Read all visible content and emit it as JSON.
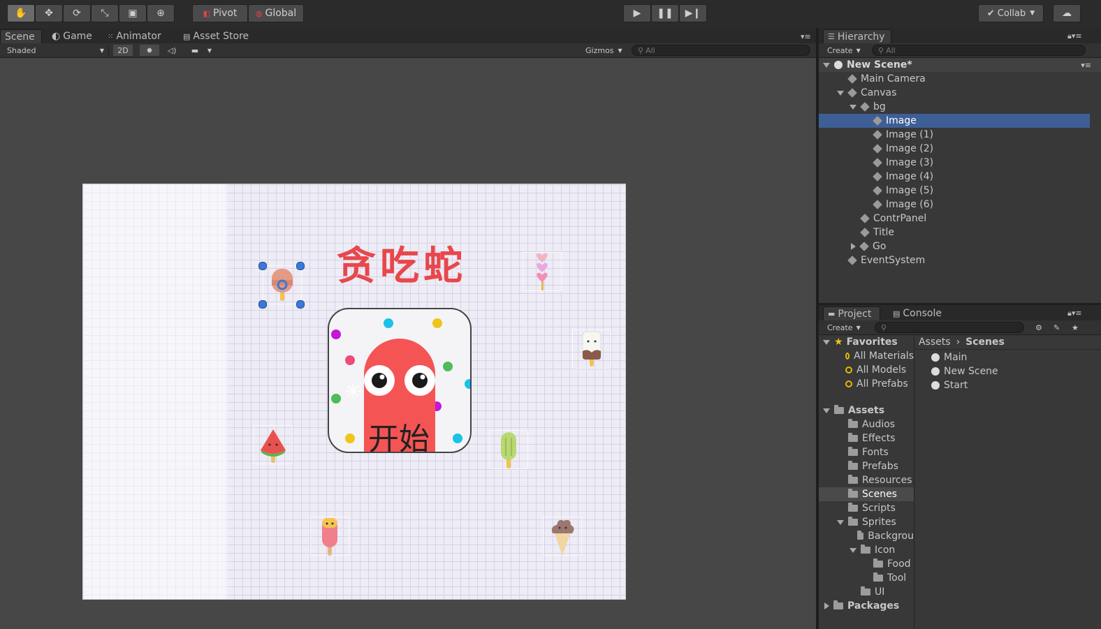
{
  "toolbar": {
    "pivot_label": "Pivot",
    "global_label": "Global",
    "collab_label": "Collab"
  },
  "scene_tabs": [
    {
      "label": "Scene",
      "selected": true
    },
    {
      "label": "Game",
      "selected": false
    },
    {
      "label": "Animator",
      "selected": false
    },
    {
      "label": "Asset Store",
      "selected": false
    }
  ],
  "scene_bar": {
    "shading_mode": "Shaded",
    "mode_2d": "2D",
    "gizmos_label": "Gizmos",
    "search_placeholder": "All"
  },
  "game": {
    "title": "贪吃蛇",
    "start_label": "开始",
    "title_color": "#e8474c",
    "ghost_color": "#f55454"
  },
  "hierarchy": {
    "tab_label": "Hierarchy",
    "create_label": "Create",
    "search_placeholder": "All",
    "scene_name": "New Scene*",
    "items": [
      {
        "label": "Main Camera",
        "depth": 1,
        "arrow": "",
        "selected": false
      },
      {
        "label": "Canvas",
        "depth": 1,
        "arrow": "down",
        "selected": false
      },
      {
        "label": "bg",
        "depth": 2,
        "arrow": "down",
        "selected": false
      },
      {
        "label": "Image",
        "depth": 3,
        "arrow": "",
        "selected": true
      },
      {
        "label": "Image (1)",
        "depth": 3,
        "arrow": "",
        "selected": false
      },
      {
        "label": "Image (2)",
        "depth": 3,
        "arrow": "",
        "selected": false
      },
      {
        "label": "Image (3)",
        "depth": 3,
        "arrow": "",
        "selected": false
      },
      {
        "label": "Image (4)",
        "depth": 3,
        "arrow": "",
        "selected": false
      },
      {
        "label": "Image (5)",
        "depth": 3,
        "arrow": "",
        "selected": false
      },
      {
        "label": "Image (6)",
        "depth": 3,
        "arrow": "",
        "selected": false
      },
      {
        "label": "ContrPanel",
        "depth": 2,
        "arrow": "",
        "selected": false
      },
      {
        "label": "Title",
        "depth": 2,
        "arrow": "",
        "selected": false
      },
      {
        "label": "Go",
        "depth": 2,
        "arrow": "right",
        "selected": false
      },
      {
        "label": "EventSystem",
        "depth": 1,
        "arrow": "",
        "selected": false
      }
    ]
  },
  "project": {
    "tab_project": "Project",
    "tab_console": "Console",
    "create_label": "Create",
    "favorites_label": "Favorites",
    "favorites": [
      "All Materials",
      "All Models",
      "All Prefabs"
    ],
    "assets_label": "Assets",
    "folders": [
      {
        "label": "Audios",
        "depth": 1,
        "arrow": "",
        "selected": false
      },
      {
        "label": "Effects",
        "depth": 1,
        "arrow": "",
        "selected": false
      },
      {
        "label": "Fonts",
        "depth": 1,
        "arrow": "",
        "selected": false
      },
      {
        "label": "Prefabs",
        "depth": 1,
        "arrow": "",
        "selected": false
      },
      {
        "label": "Resources",
        "depth": 1,
        "arrow": "",
        "selected": false
      },
      {
        "label": "Scenes",
        "depth": 1,
        "arrow": "",
        "selected": true
      },
      {
        "label": "Scripts",
        "depth": 1,
        "arrow": "",
        "selected": false
      },
      {
        "label": "Sprites",
        "depth": 1,
        "arrow": "down",
        "selected": false
      },
      {
        "label": "Backgrou",
        "depth": 2,
        "arrow": "",
        "selected": false
      },
      {
        "label": "Icon",
        "depth": 2,
        "arrow": "down",
        "selected": false
      },
      {
        "label": "Food",
        "depth": 3,
        "arrow": "",
        "selected": false
      },
      {
        "label": "Tool",
        "depth": 3,
        "arrow": "",
        "selected": false
      },
      {
        "label": "UI",
        "depth": 2,
        "arrow": "",
        "selected": false
      }
    ],
    "packages_label": "Packages",
    "breadcrumb": [
      "Assets",
      "Scenes"
    ],
    "scene_files": [
      "Main",
      "New Scene",
      "Start"
    ]
  }
}
